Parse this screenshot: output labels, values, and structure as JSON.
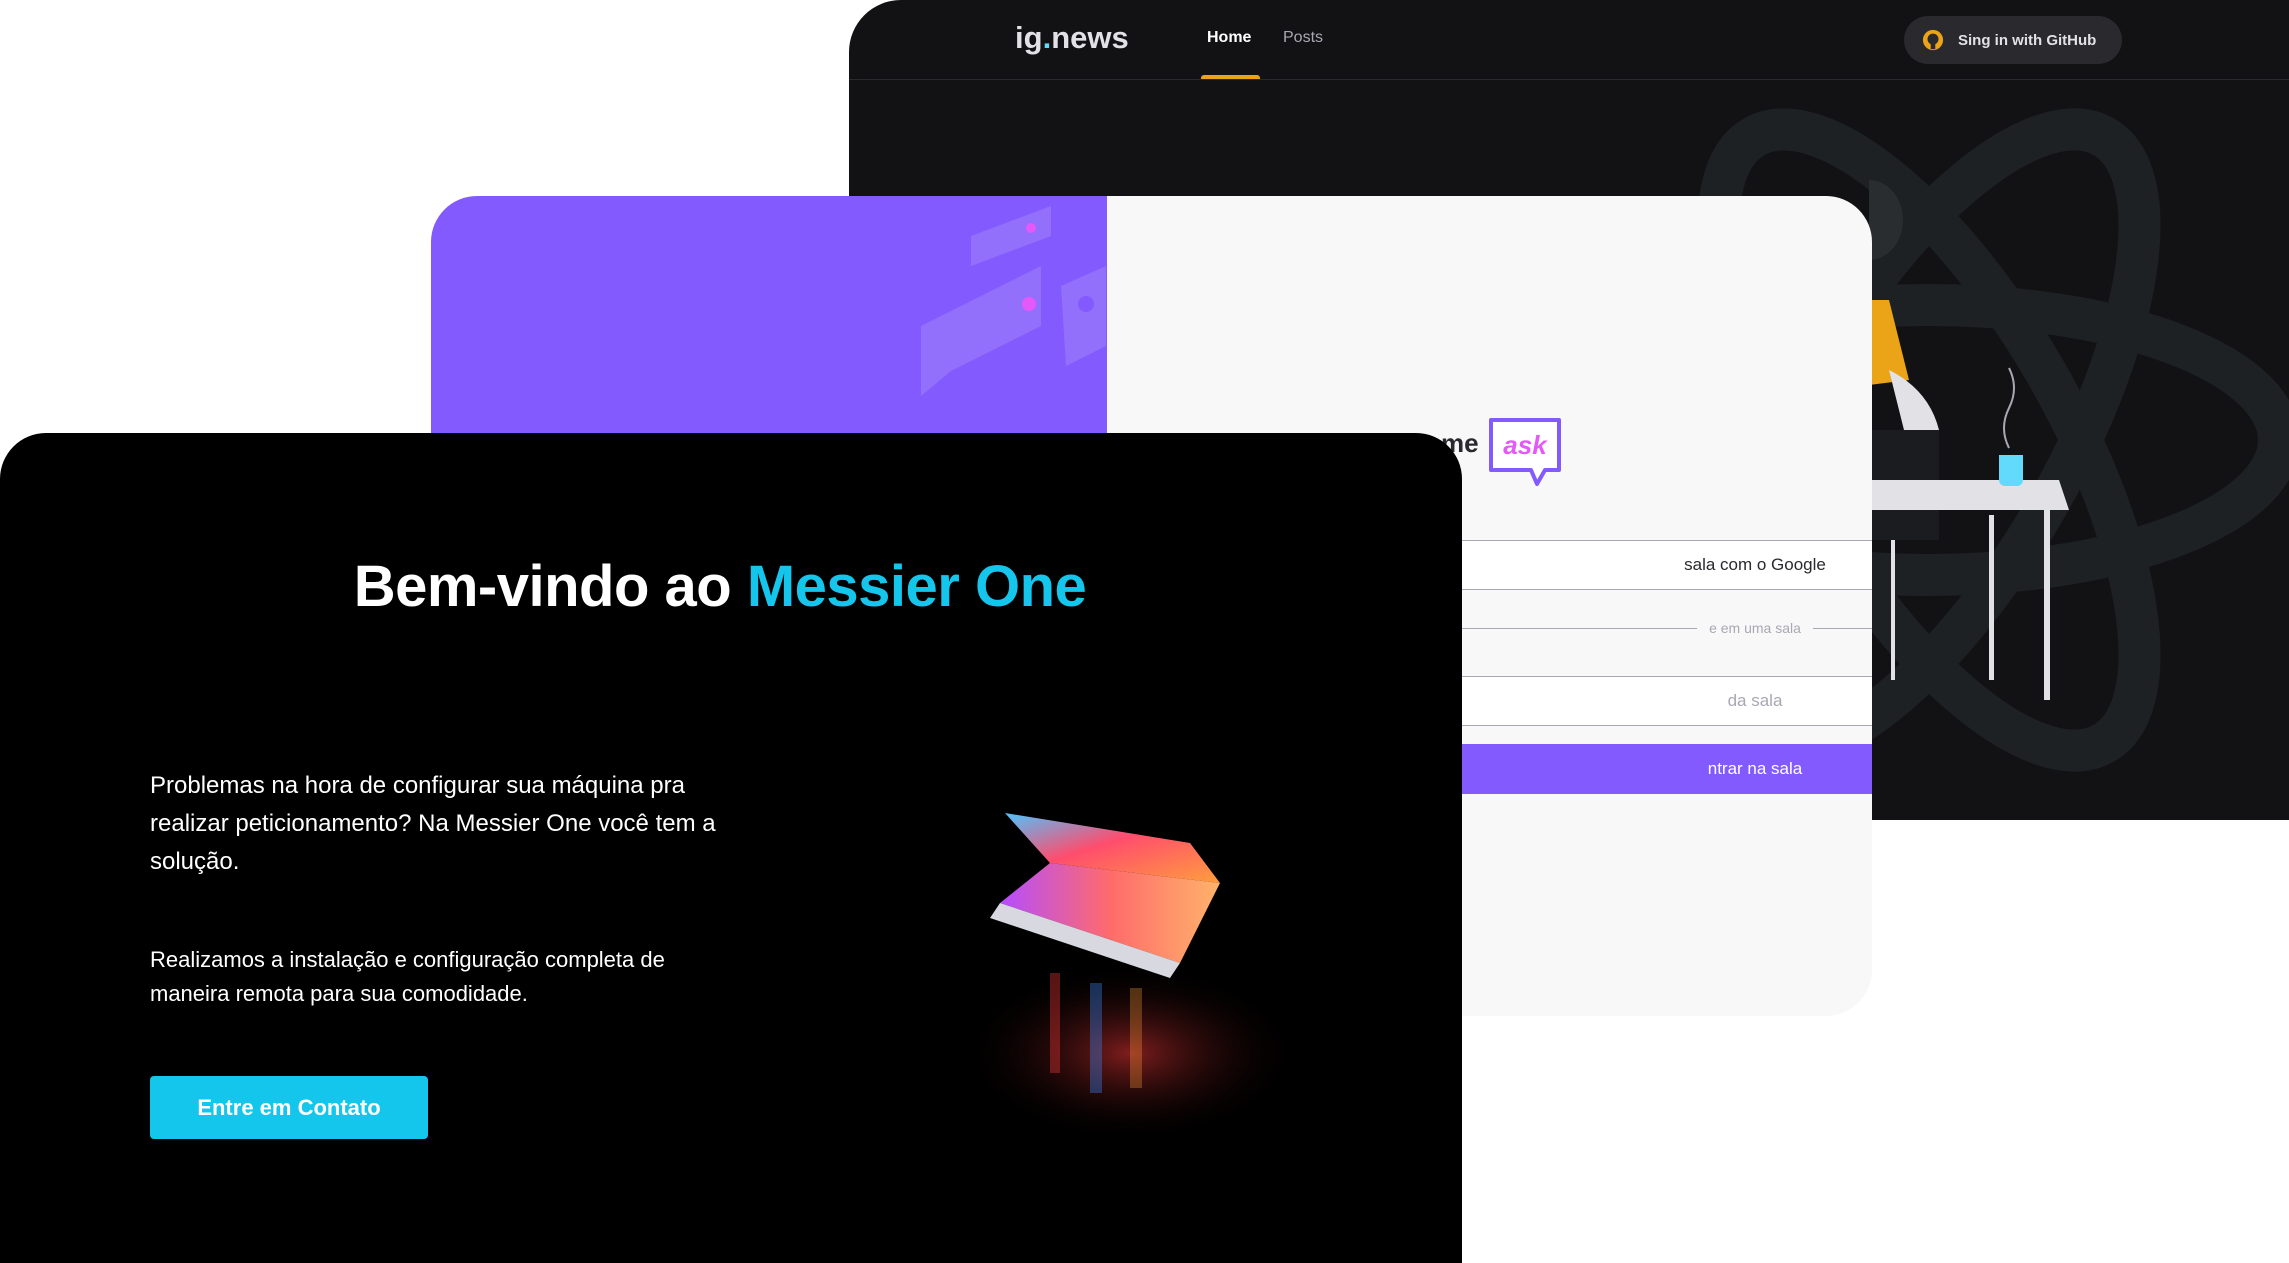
{
  "ig_news": {
    "logo_main": "ig",
    "logo_dot": ".",
    "logo_suffix": "news",
    "nav": {
      "home": "Home",
      "posts": "Posts"
    },
    "signin_label": "Sing in with GitHub",
    "signin_icon": "github-icon",
    "accent": "#eba417"
  },
  "letmeask": {
    "logo_visible": "me",
    "logo_badge": "ask",
    "google_button": "sala com o Google",
    "separator": "e em uma sala",
    "room_input_placeholder": "da sala",
    "enter_button": "ntrar na sala",
    "accent": "#835afd"
  },
  "messier_one": {
    "title_prefix": "Bem-vindo ao ",
    "title_accent": "Messier One",
    "paragraph_1": "Problemas na hora de configurar sua máquina pra realizar peticionamento? Na Messier One você tem a solução.",
    "paragraph_2": "Realizamos a instalação e configuração completa de maneira remota para sua comodidade.",
    "cta": "Entre em Contato",
    "accent": "#14c5ec"
  }
}
